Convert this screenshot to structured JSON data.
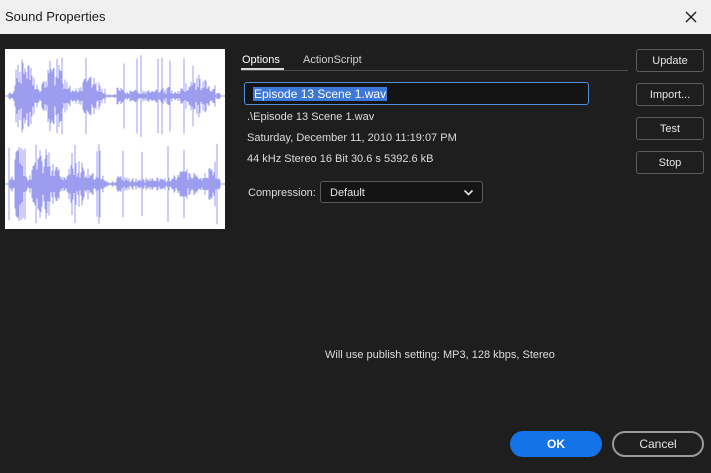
{
  "window": {
    "title": "Sound Properties",
    "close_icon": "close-icon"
  },
  "preview": {
    "waveform_color": "#9d9df0",
    "channels": 2
  },
  "tabs": [
    {
      "label": "Options",
      "active": true
    },
    {
      "label": "ActionScript",
      "active": false
    }
  ],
  "sound": {
    "name": "Episode 13 Scene 1.wav",
    "path": ".\\Episode 13 Scene 1.wav",
    "date": "Saturday, December 11, 2010  11:19:07 PM",
    "format": "44 kHz Stereo 16 Bit 30.6 s 5392.6 kB"
  },
  "compression": {
    "label": "Compression:",
    "value": "Default"
  },
  "side_buttons": {
    "update": "Update",
    "import": "Import...",
    "test": "Test",
    "stop": "Stop"
  },
  "publish_note": "Will use publish setting: MP3, 128 kbps, Stereo",
  "footer": {
    "ok": "OK",
    "cancel": "Cancel"
  },
  "colors": {
    "accent": "#1473e6",
    "background": "#1e1e1e",
    "titlebar": "#f0f0f0"
  }
}
